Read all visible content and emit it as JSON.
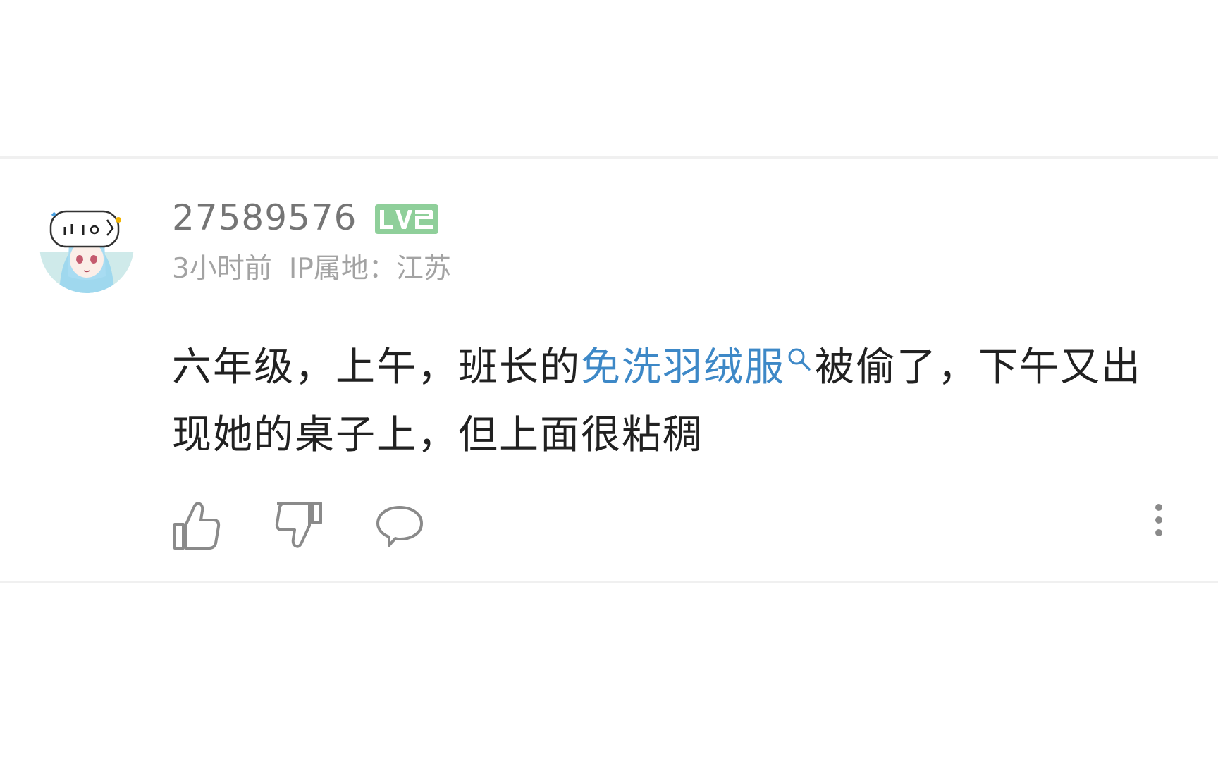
{
  "comment": {
    "username": "27589576",
    "level": "LV2",
    "time": "3小时前",
    "ip_location": "IP属地：江苏",
    "content": {
      "before": "六年级，上午，班长的",
      "link": "免洗羽绒服",
      "after": "被偷了，下午又出现她的桌子上，但上面很粘稠"
    }
  },
  "icons": {
    "avatar": "anime-avatar",
    "search": "search-icon",
    "like": "thumbs-up-icon",
    "dislike": "thumbs-down-icon",
    "reply": "comment-bubble-icon",
    "more": "more-vertical-icon"
  },
  "colors": {
    "link": "#3d88c7",
    "level_badge": "#8fcf9a",
    "text": "#212121",
    "meta": "#a3a3a3"
  }
}
